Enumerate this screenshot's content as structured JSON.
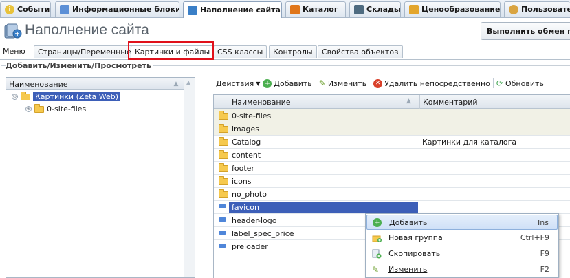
{
  "top_tabs": [
    {
      "label": "События",
      "icon": "info-icon",
      "color": "#e8c23a"
    },
    {
      "label": "Информационные блоки",
      "icon": "blocks-icon",
      "color": "#5b8fd6"
    },
    {
      "label": "Наполнение сайта",
      "icon": "site-content-icon",
      "color": "#3a7fc7",
      "active": true
    },
    {
      "label": "Каталог",
      "icon": "catalog-icon",
      "color": "#e0761a"
    },
    {
      "label": "Склады",
      "icon": "warehouse-icon",
      "color": "#4e6b80"
    },
    {
      "label": "Ценообразование",
      "icon": "pricing-icon",
      "color": "#e3a52c"
    },
    {
      "label": "Пользовате",
      "icon": "users-icon",
      "color": "#d9a441"
    }
  ],
  "header": {
    "title": "Наполнение сайта",
    "sync_button": "Выполнить обмен по"
  },
  "sub_tabs": [
    {
      "label": "Меню"
    },
    {
      "label": "Страницы/Переменные"
    },
    {
      "label": "Картинки и файлы",
      "active": true
    },
    {
      "label": "CSS классы"
    },
    {
      "label": "Контролы"
    },
    {
      "label": "Свойства объектов"
    }
  ],
  "group_title": "Добавить/Изменить/Просмотреть",
  "tree": {
    "header": "Наименование",
    "items": [
      {
        "label": "Картинки (Zeta Web)",
        "selected": true,
        "expander": "⊖"
      },
      {
        "label": "0-site-files",
        "expander": "⊕"
      }
    ]
  },
  "toolbar": {
    "actions": "Действия",
    "add": "Добавить",
    "edit": "Изменить",
    "delete": "Удалить непосредственно",
    "refresh": "Обновить"
  },
  "grid": {
    "columns": [
      "Наименование",
      "Комментарий"
    ],
    "rows": [
      {
        "name": "0-site-files",
        "comment": "",
        "type": "folder",
        "shaded": true
      },
      {
        "name": "images",
        "comment": "",
        "type": "folder",
        "shaded": true
      },
      {
        "name": "Catalog",
        "comment": "Картинки для каталога",
        "type": "folder"
      },
      {
        "name": "content",
        "comment": "",
        "type": "folder"
      },
      {
        "name": "footer",
        "comment": "",
        "type": "folder"
      },
      {
        "name": "icons",
        "comment": "",
        "type": "folder"
      },
      {
        "name": "no_photo",
        "comment": "",
        "type": "folder"
      },
      {
        "name": "favicon",
        "comment": "",
        "type": "file",
        "selected": true
      },
      {
        "name": "header-logo",
        "comment": "",
        "type": "file"
      },
      {
        "name": "label_spec_price",
        "comment": "",
        "type": "file"
      },
      {
        "name": "preloader",
        "comment": "",
        "type": "file"
      }
    ]
  },
  "context_menu": [
    {
      "label": "Добавить",
      "shortcut": "Ins",
      "icon": "add-icon",
      "hover": true
    },
    {
      "label": "Новая группа",
      "shortcut": "Ctrl+F9",
      "icon": "new-group-icon"
    },
    {
      "label": "Скопировать",
      "shortcut": "F9",
      "icon": "copy-icon"
    },
    {
      "label": "Изменить",
      "shortcut": "F2",
      "icon": "edit-icon"
    }
  ],
  "colors": {
    "selection": "#3d5fb8",
    "highlight_frame": "#e0111b",
    "folder": "#f6c94e"
  }
}
